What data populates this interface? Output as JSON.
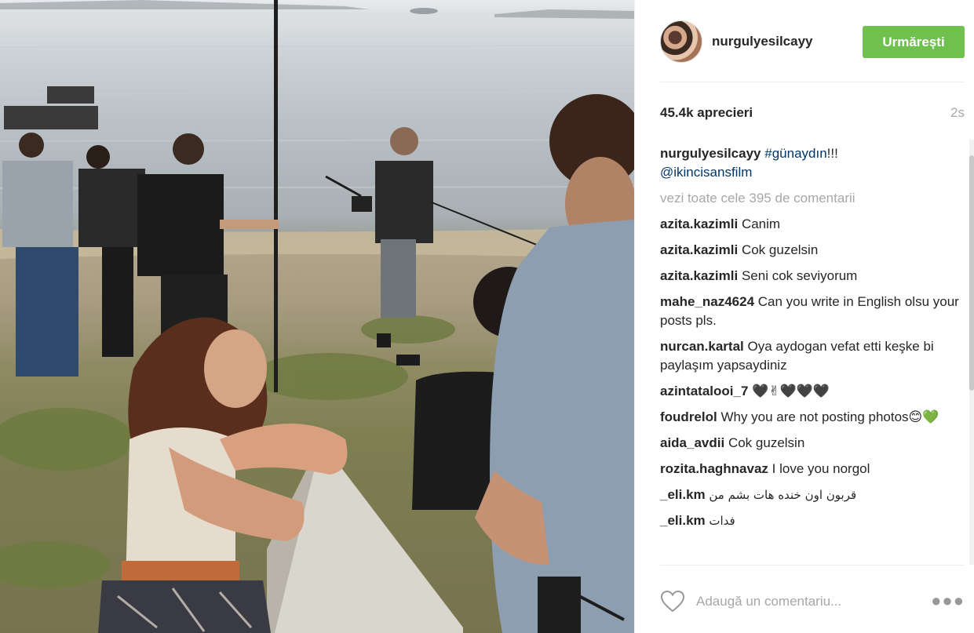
{
  "post": {
    "username": "nurgulyesilcayy",
    "follow_label": "Urmărești",
    "likes": "45.4k aprecieri",
    "time": "2s",
    "caption_tag": "#günaydın",
    "caption_suffix": "!!!",
    "caption_mention": "@ikincisansfilm",
    "view_all": "vezi toate cele 395 de comentarii"
  },
  "comments": [
    {
      "author": "azita.kazimli",
      "text": "Canim"
    },
    {
      "author": "azita.kazimli",
      "text": "Cok guzelsin"
    },
    {
      "author": "azita.kazimli",
      "text": "Seni cok seviyorum"
    },
    {
      "author": "mahe_naz4624",
      "text": "Can you write in English olsu your posts pls."
    },
    {
      "author": "nurcan.kartal",
      "text": "Oya aydogan vefat etti keşke bi paylaşım yapsaydiniz"
    },
    {
      "author": "azintatalooi_7",
      "text": "🖤✌🖤🖤🖤"
    },
    {
      "author": "foudrelol",
      "text": "Why you are not posting photos😊💚"
    },
    {
      "author": "aida_avdii",
      "text": "Cok guzelsin"
    },
    {
      "author": "rozita.haghnavaz",
      "text": "I love you norgol"
    },
    {
      "author": "_eli.km",
      "text": "قربون اون خنده هات بشم من"
    },
    {
      "author": "_eli.km",
      "text": "فدات"
    }
  ],
  "footer": {
    "comment_placeholder": "Adaugă un comentariu..."
  },
  "colors": {
    "follow_button": "#70c050",
    "link": "#003569",
    "muted": "#a5a7aa"
  },
  "icons": {
    "like": "heart-icon",
    "options": "more-options-icon"
  }
}
